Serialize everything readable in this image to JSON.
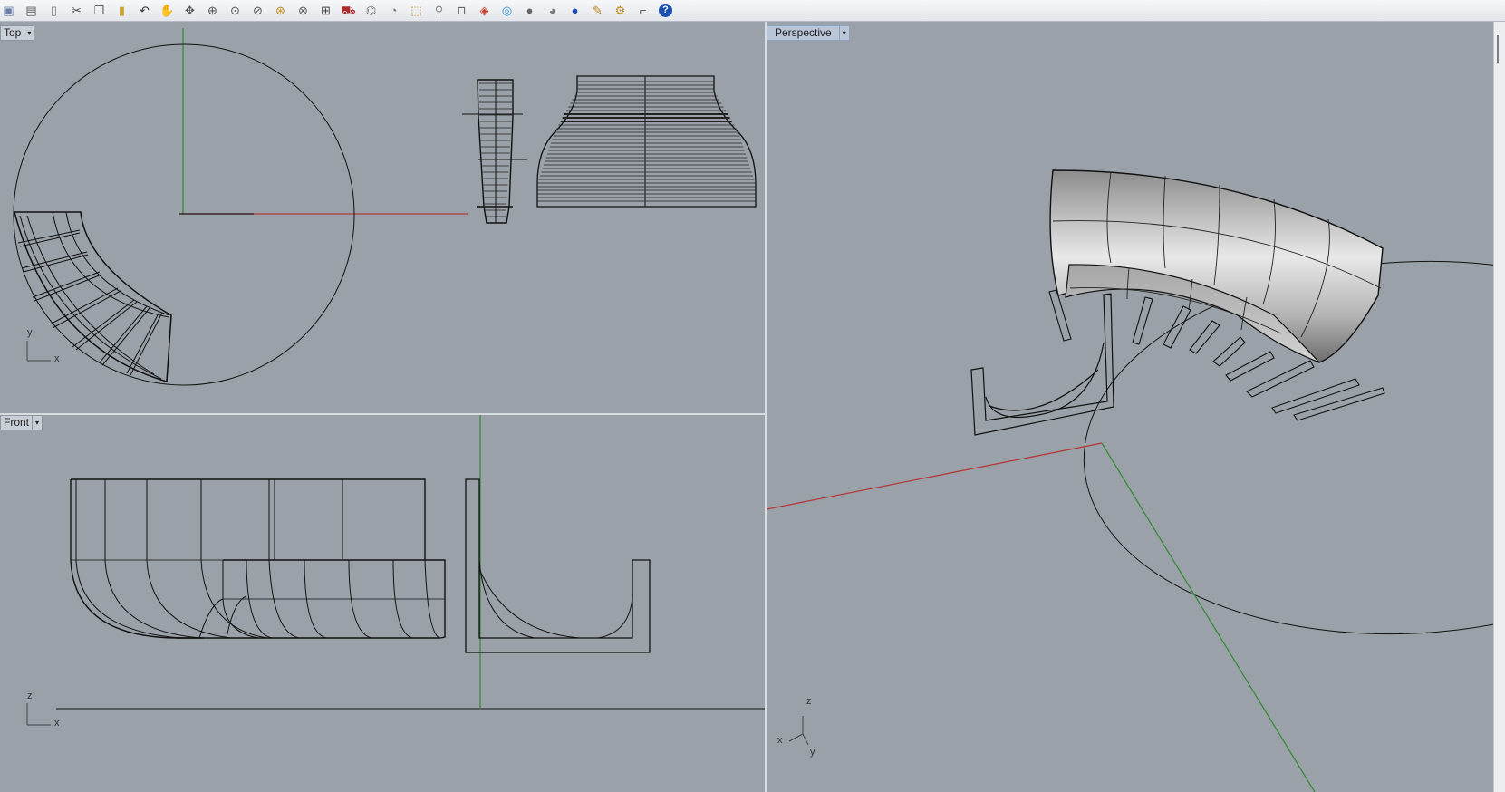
{
  "toolbar": {
    "buttons": [
      {
        "icon": "save-icon"
      },
      {
        "icon": "print-icon"
      },
      {
        "icon": "new-file-icon"
      },
      {
        "icon": "cut-icon"
      },
      {
        "icon": "copy-icon"
      },
      {
        "icon": "paste-icon"
      },
      {
        "icon": "undo-icon"
      },
      {
        "icon": "pan-hand-icon"
      },
      {
        "icon": "rotate-view-icon"
      },
      {
        "icon": "zoom-dynamic-icon"
      },
      {
        "icon": "zoom-window-icon"
      },
      {
        "icon": "zoom-extents-icon"
      },
      {
        "icon": "zoom-selected-icon"
      },
      {
        "icon": "zoom-all-icon"
      },
      {
        "icon": "four-viewports-icon"
      },
      {
        "icon": "named-view-icon"
      },
      {
        "icon": "camera-icon"
      },
      {
        "icon": "named-cplane-icon"
      },
      {
        "icon": "select-objects-icon"
      },
      {
        "icon": "light-bulb-icon"
      },
      {
        "icon": "lock-icon"
      },
      {
        "icon": "layers-icon"
      },
      {
        "icon": "color-wheel-icon"
      },
      {
        "icon": "render-sphere-icon"
      },
      {
        "icon": "render-sphere-shaded-icon"
      },
      {
        "icon": "material-sphere-icon"
      },
      {
        "icon": "pencil-icon"
      },
      {
        "icon": "options-gear-icon"
      },
      {
        "icon": "snap-icon"
      },
      {
        "icon": "help-icon"
      }
    ]
  },
  "viewports": {
    "top": {
      "label": "Top",
      "axis_a": "y",
      "axis_b": "x"
    },
    "front": {
      "label": "Front",
      "axis_a": "z",
      "axis_b": "x"
    },
    "perspective": {
      "label": "Perspective",
      "axis_a": "z",
      "axis_b": "x",
      "axis_c": "y"
    }
  },
  "colors": {
    "viewport_bg": "#9aa1a8",
    "x_axis": "#b23a3a",
    "y_axis": "#3a8a3a",
    "geometry": "#111111",
    "active_label": "#b9c6d8"
  }
}
